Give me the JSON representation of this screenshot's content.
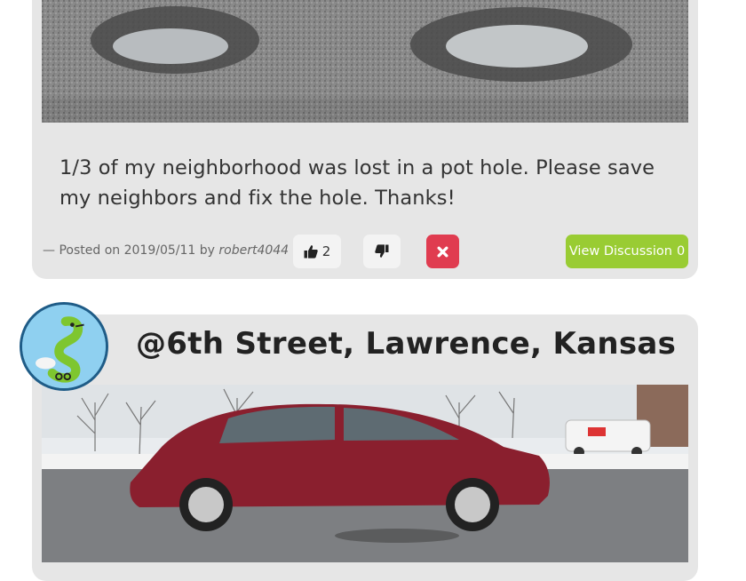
{
  "post1": {
    "text": "1/3 of my neighborhood was lost in a pot hole. Please save my neighbors and fix the hole. Thanks!",
    "posted_prefix": "— Posted on",
    "date": "2019/05/11",
    "by": "by",
    "author": "robert4044",
    "likes": "2",
    "view_discussion_label": "View Discussion",
    "discussion_count": "0"
  },
  "post2": {
    "title": "@6th Street, Lawrence, Kansas"
  },
  "icons": {
    "like": "thumbs-up-icon",
    "dislike": "thumbs-down-icon",
    "delete": "close-icon",
    "avatar": "snake-mascot-icon"
  },
  "colors": {
    "card_bg": "#e6e6e6",
    "like_bg": "#f3f3f3",
    "delete_bg": "#e03c50",
    "view_btn_bg": "#99cc33",
    "avatar_border": "#1f5c87"
  }
}
